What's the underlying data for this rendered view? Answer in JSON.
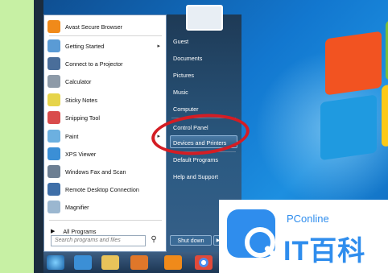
{
  "left_menu": {
    "items": [
      {
        "label": "Avast Secure Browser",
        "color": "#f08a1a",
        "arrow": false
      },
      {
        "label": "Getting Started",
        "color": "#5a9bd5",
        "arrow": true
      },
      {
        "label": "Connect to a Projector",
        "color": "#4a6e9a",
        "arrow": false
      },
      {
        "label": "Calculator",
        "color": "#8d9aa8",
        "arrow": false
      },
      {
        "label": "Sticky Notes",
        "color": "#e6d44a",
        "arrow": false
      },
      {
        "label": "Snipping Tool",
        "color": "#d94c4c",
        "arrow": false
      },
      {
        "label": "Paint",
        "color": "#6cb0e0",
        "arrow": true
      },
      {
        "label": "XPS Viewer",
        "color": "#3b8fd6",
        "arrow": false
      },
      {
        "label": "Windows Fax and Scan",
        "color": "#6d7f93",
        "arrow": false
      },
      {
        "label": "Remote Desktop Connection",
        "color": "#3f6fa8",
        "arrow": false
      },
      {
        "label": "Magnifier",
        "color": "#9bb7d0",
        "arrow": false
      }
    ],
    "all_programs": "All Programs",
    "search_placeholder": "Search programs and files"
  },
  "right_menu": {
    "items": [
      "Guest",
      "Documents",
      "Pictures",
      "Music",
      "Computer",
      "Control Panel",
      "Devices and Printers",
      "Default Programs",
      "Help and Support"
    ],
    "shutdown": "Shut down"
  },
  "watermark": {
    "brand": "PConline",
    "name": "IT百科"
  },
  "colors": {
    "annotation": "#d41d24",
    "accent": "#2f8ded"
  }
}
